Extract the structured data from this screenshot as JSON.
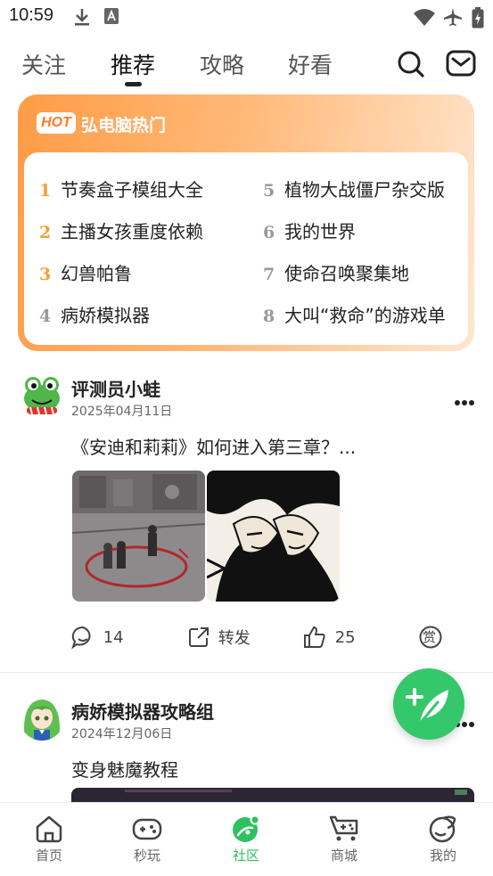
{
  "status_bar": {
    "time": "10:59"
  },
  "top_tabs": [
    {
      "label": "关注"
    },
    {
      "label": "推荐"
    },
    {
      "label": "攻略"
    },
    {
      "label": "好看"
    }
  ],
  "active_tab": "推荐",
  "hot": {
    "badge": "HOT",
    "title": "弘电脑热门",
    "items": [
      {
        "rank": "1",
        "title": "节奏盒子模组大全"
      },
      {
        "rank": "2",
        "title": "主播女孩重度依赖"
      },
      {
        "rank": "3",
        "title": "幻兽帕鲁"
      },
      {
        "rank": "4",
        "title": "病娇模拟器"
      },
      {
        "rank": "5",
        "title": "植物大战僵尸杂交版"
      },
      {
        "rank": "6",
        "title": "我的世界"
      },
      {
        "rank": "7",
        "title": "使命召唤聚集地"
      },
      {
        "rank": "8",
        "title": "大叫“救命”的游戏单"
      }
    ]
  },
  "posts": [
    {
      "author": "评测员小蛙",
      "date": "2025年04月11日",
      "text": "《安迪和莉莉》如何进入第三章？...",
      "comments": "14",
      "share_label": "转发",
      "likes": "25",
      "reward_label": "赏"
    },
    {
      "author": "病娇模拟器攻略组",
      "date": "2024年12月06日",
      "text": "变身魅魔教程"
    }
  ],
  "bottom_nav": [
    {
      "label": "首页"
    },
    {
      "label": "秒玩"
    },
    {
      "label": "社区"
    },
    {
      "label": "商城"
    },
    {
      "label": "我的"
    }
  ],
  "colors": {
    "accent_green": "#2fc15f",
    "hot_orange": "#ff8a2a",
    "rank_top": "#f3a132"
  }
}
